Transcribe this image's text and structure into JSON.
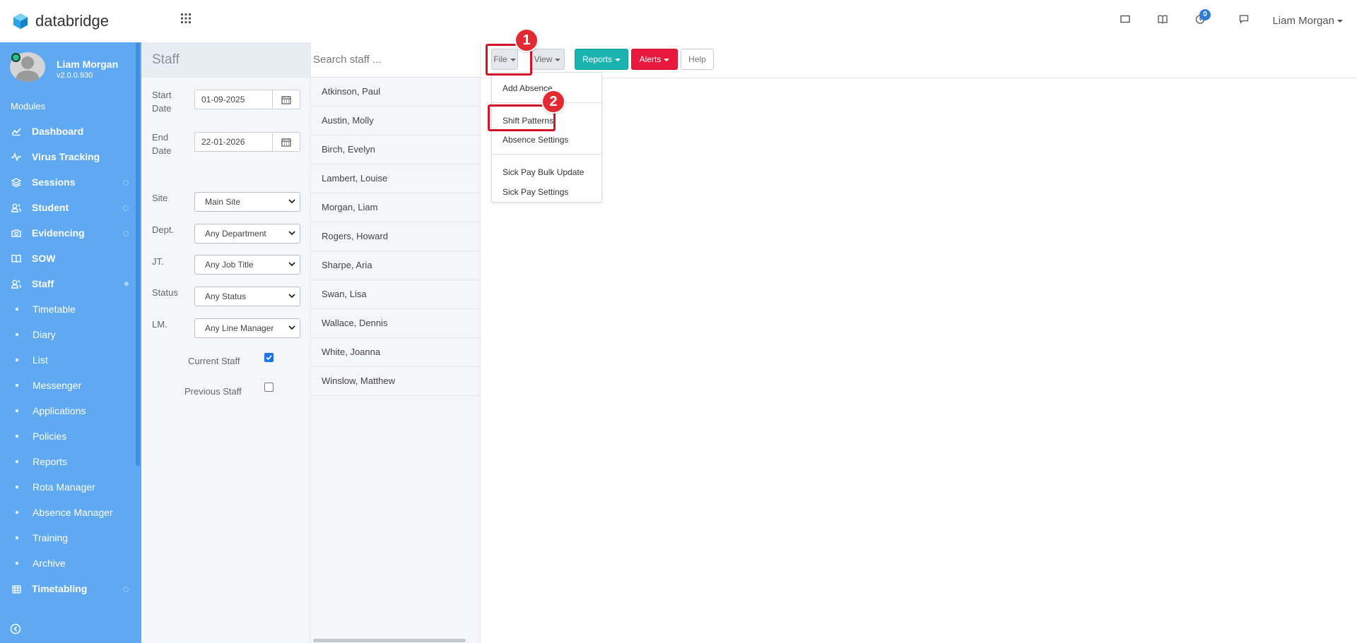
{
  "app": {
    "name": "databridge",
    "brand_color": "#2aa3e8"
  },
  "header": {
    "user_name": "Liam Morgan",
    "notification_count": "0",
    "icons": [
      "window-icon",
      "book-icon",
      "clock-icon",
      "chat-icon"
    ]
  },
  "sidebar": {
    "profile": {
      "name": "Liam Morgan",
      "version": "v2.0.0.930"
    },
    "modules_label": "Modules",
    "items": [
      {
        "label": "Dashboard",
        "icon": "chart-line-icon"
      },
      {
        "label": "Virus Tracking",
        "icon": "pulse-icon"
      },
      {
        "label": "Sessions",
        "icon": "layers-icon"
      },
      {
        "label": "Student",
        "icon": "users-icon"
      },
      {
        "label": "Evidencing",
        "icon": "camera-icon"
      },
      {
        "label": "SOW",
        "icon": "book-open-icon"
      },
      {
        "label": "Staff",
        "icon": "staff-icon"
      }
    ],
    "staff_subitems": [
      "Timetable",
      "Diary",
      "List",
      "Messenger",
      "Applications",
      "Policies",
      "Reports",
      "Rota Manager",
      "Absence Manager",
      "Training",
      "Archive"
    ],
    "timetabling": {
      "label": "Timetabling",
      "icon": "calendar-grid-icon"
    },
    "color": "#5ea9f2"
  },
  "filters": {
    "title": "Staff",
    "start_date_label": "Start Date",
    "start_date": "01-09-2025",
    "end_date_label": "End Date",
    "end_date": "22-01-2026",
    "site_label": "Site",
    "site_value": "Main Site",
    "dept_label": "Dept.",
    "dept_value": "Any Department",
    "jt_label": "JT.",
    "jt_value": "Any Job Title",
    "status_label": "Status",
    "status_value": "Any Status",
    "lm_label": "LM.",
    "lm_value": "Any Line Manager",
    "current_staff_label": "Current Staff",
    "current_staff_checked": true,
    "previous_staff_label": "Previous Staff",
    "previous_staff_checked": false
  },
  "staff_list": {
    "search_placeholder": "Search staff ...",
    "items": [
      "Atkinson, Paul",
      "Austin, Molly",
      "Birch, Evelyn",
      "Lambert, Louise",
      "Morgan, Liam",
      "Rogers, Howard",
      "Sharpe, Aria",
      "Swan, Lisa",
      "Wallace, Dennis",
      "White, Joanna",
      "Winslow, Matthew"
    ]
  },
  "toolbar": {
    "file": "File",
    "view": "View",
    "reports": "Reports",
    "alerts": "Alerts",
    "help": "Help",
    "reports_color": "#1ab3b0",
    "alerts_color": "#e8183d"
  },
  "file_menu": {
    "items": [
      "Add Absence",
      "Shift Patterns",
      "Absence Settings",
      "Sick Pay Bulk Update",
      "Sick Pay Settings"
    ]
  },
  "annotations": {
    "step1": "1",
    "step2": "2",
    "color": "#d3132a"
  }
}
